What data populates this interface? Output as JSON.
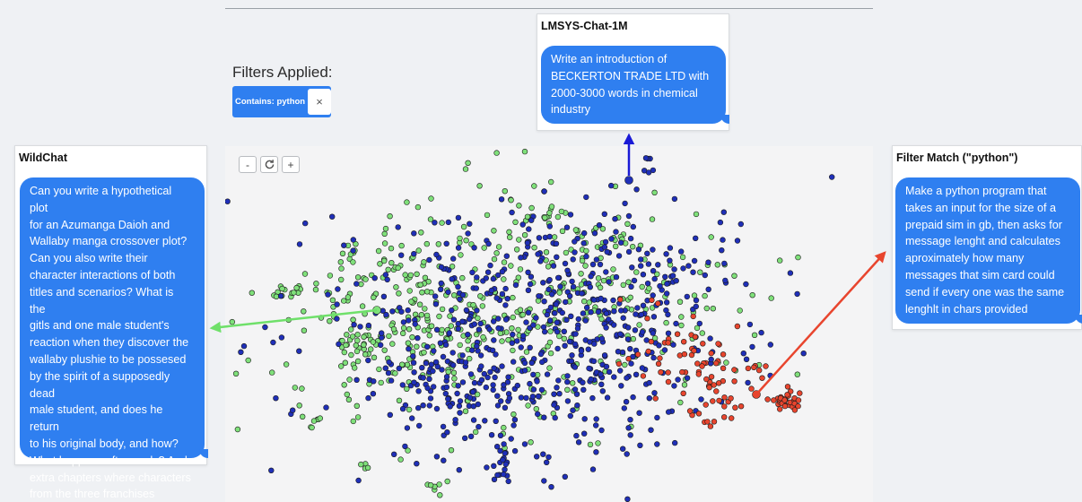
{
  "filters": {
    "title": "Filters Applied:",
    "chips": [
      {
        "label": "Contains: python",
        "remove_glyph": "×"
      }
    ]
  },
  "zoom_controls": {
    "zoom_out": "-",
    "reset_icon": "refresh-icon",
    "zoom_in": "+"
  },
  "panels": {
    "top": {
      "title": "LMSYS-Chat-1M",
      "message": "Write an introduction of\nBECKERTON TRADE  LTD with\n2000-3000 words in chemical\nindustry"
    },
    "left": {
      "title": "WildChat",
      "message": "Can you write a hypothetical plot\nfor an Azumanga Daioh and\nWallaby manga crossover plot?\nCan you also write their\ncharacter interactions of both\ntitles and scenarios? What is the\ngitls and one male student's\nreaction when they discover the\nwallaby plushie to be possesed\nby the spirit of a supposedly dead\nmale student, and does he return\nto his original body, and how?\nWhat happens afterwards? And\nextra chapters where characters\nfrom the three franchises\ninteract?"
    },
    "right": {
      "title": "Filter Match (\"python\")",
      "message": "Make a python program that\ntakes an input for the size of a\nprepaid sim in gb, then asks for\nmessage lenght and calculates\naproximately how many\nmessages that sim card could\nsend if every one was the same\nlenghlt in chars provided"
    }
  },
  "colors": {
    "lmsys_points": "#1f2fb8",
    "wildchat_points": "#7fe07a",
    "filter_match_points": "#e8452e",
    "bubble": "#2f7ff0",
    "arrow_top": "#1a1ad6",
    "arrow_left": "#6fe06a",
    "arrow_right": "#e8452e"
  }
}
